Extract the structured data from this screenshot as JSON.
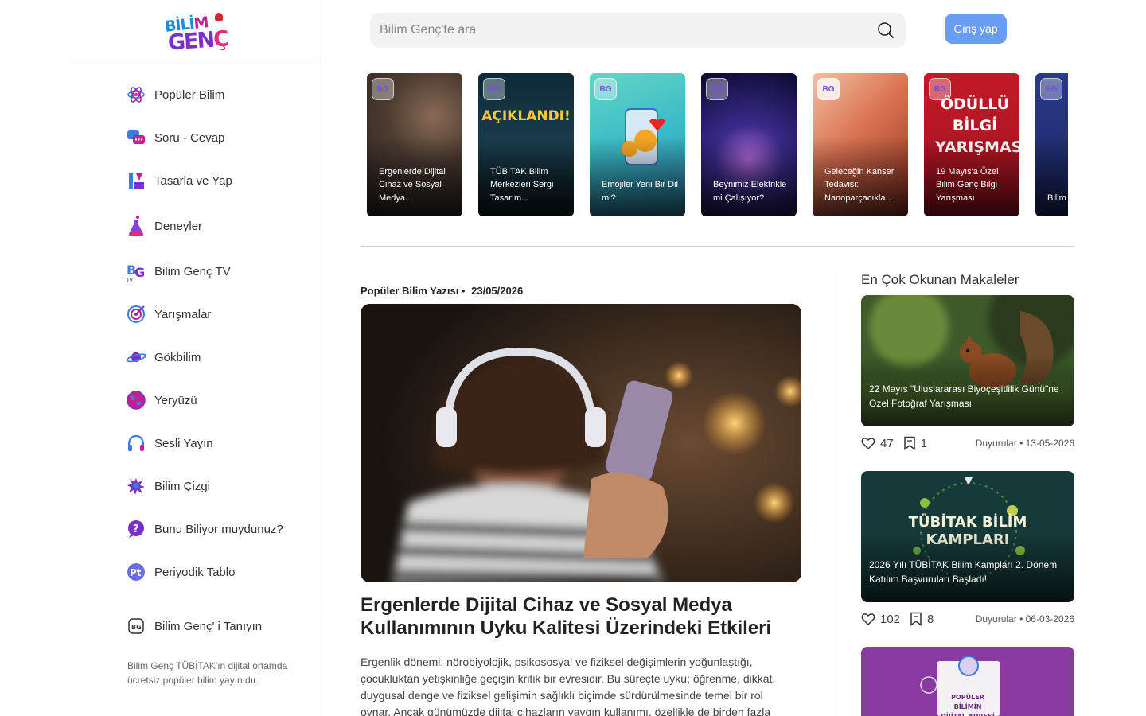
{
  "brand": {
    "logo_text_top_a": "BİLİ",
    "logo_text_top_b": "M",
    "logo_text_bottom_a": "GEN",
    "logo_text_bottom_b": "Ç"
  },
  "search": {
    "placeholder": "Bilim Genç'te ara"
  },
  "header": {
    "login_label": "Giriş yap"
  },
  "sidebar": {
    "items": [
      {
        "label": "Popüler Bilim",
        "icon": "atom-icon"
      },
      {
        "label": "Soru - Cevap",
        "icon": "chat-bubbles-icon"
      },
      {
        "label": "Tasarla ve Yap",
        "icon": "ruler-tools-icon"
      },
      {
        "label": "Deneyler",
        "icon": "flask-icon"
      },
      {
        "label": "Bilim Genç TV",
        "icon": "bg-tv-icon"
      },
      {
        "label": "Yarışmalar",
        "icon": "target-icon"
      },
      {
        "label": "Gökbilim",
        "icon": "planet-icon"
      },
      {
        "label": "Yeryüzü",
        "icon": "globe-icon"
      },
      {
        "label": "Sesli Yayın",
        "icon": "headphones-icon"
      },
      {
        "label": "Bilim Çizgi",
        "icon": "splash-icon"
      },
      {
        "label": "Bunu Biliyor muydunuz?",
        "icon": "question-bubble-icon"
      },
      {
        "label": "Periyodik Tablo",
        "icon": "periodic-table-icon"
      }
    ],
    "about_label": "Bilim Genç' i Tanıyın",
    "about_desc": "Bilim Genç TÜBİTAK'ın dijital ortamda ücretsiz popüler bilim yayınıdır."
  },
  "stories": [
    {
      "text": "Ergenlerde Dijital Cihaz ve Sosyal Medya...",
      "overlay": ""
    },
    {
      "text": "TÜBİTAK Bilim Merkezleri Sergi Tasarım...",
      "overlay": "AÇIKLANDI!"
    },
    {
      "text": "Emojiler Yeni Bir Dil mi?",
      "overlay": ""
    },
    {
      "text": "Beynimiz Elektrikle mi Çalışıyor?",
      "overlay": ""
    },
    {
      "text": "Geleceğin Kanser Tedavisi: Nanoparçacıkla...",
      "overlay": ""
    },
    {
      "text": "19 Mayıs'a Özel Bilim Genç Bilgi Yarışması",
      "overlay": "ÖDÜLLÜ BİLGİ YARIŞMASI"
    },
    {
      "text": "Bilim Kafe Etkin...",
      "overlay": ""
    }
  ],
  "article": {
    "category": "Popüler Bilim Yazısı",
    "separator": "•",
    "date": "23/05/2026",
    "title": "Ergenlerde Dijital Cihaz ve Sosyal Medya Kullanımının Uyku Kalitesi Üzerindeki Etkileri",
    "body": "Ergenlik dönemi; nörobiyolojik, psikososyal ve fiziksel değişimlerin yoğunlaştığı, çocukluktan yetişkinliğe geçişin kritik bir evresidir. Bu süreçte uyku; öğrenme, dikkat, duygusal denge ve fiziksel gelişimin sağlıklı biçimde sürdürülmesinde temel bir rol oynar. Ancak günümüzde dijital cihazların yaygın kullanımı, özellikle de birden fazla"
  },
  "most_read": {
    "title": "En Çok Okunan Makaleler",
    "cards": [
      {
        "text": "22 Mayıs \"Uluslararası Biyoçeşitlilik Günü\"ne Özel Fotoğraf Yarışması",
        "likes": "47",
        "saves": "1",
        "category": "Duyurular",
        "date": "13-05-2026"
      },
      {
        "text": "2026 Yılı TÜBİTAK Bilim Kampları 2. Dönem Katılım Başvuruları Başladı!",
        "likes": "102",
        "saves": "8",
        "category": "Duyurular",
        "date": "06-03-2026",
        "overlay": "TÜBİTAK BİLİM KAMPLARI"
      },
      {
        "text": "",
        "overlay": "POPÜLER BİLİMİN DİJİTAL ADRESİ"
      }
    ]
  },
  "colors": {
    "accent": "#6a9cf4",
    "text": "#222222",
    "muted": "#666666"
  }
}
